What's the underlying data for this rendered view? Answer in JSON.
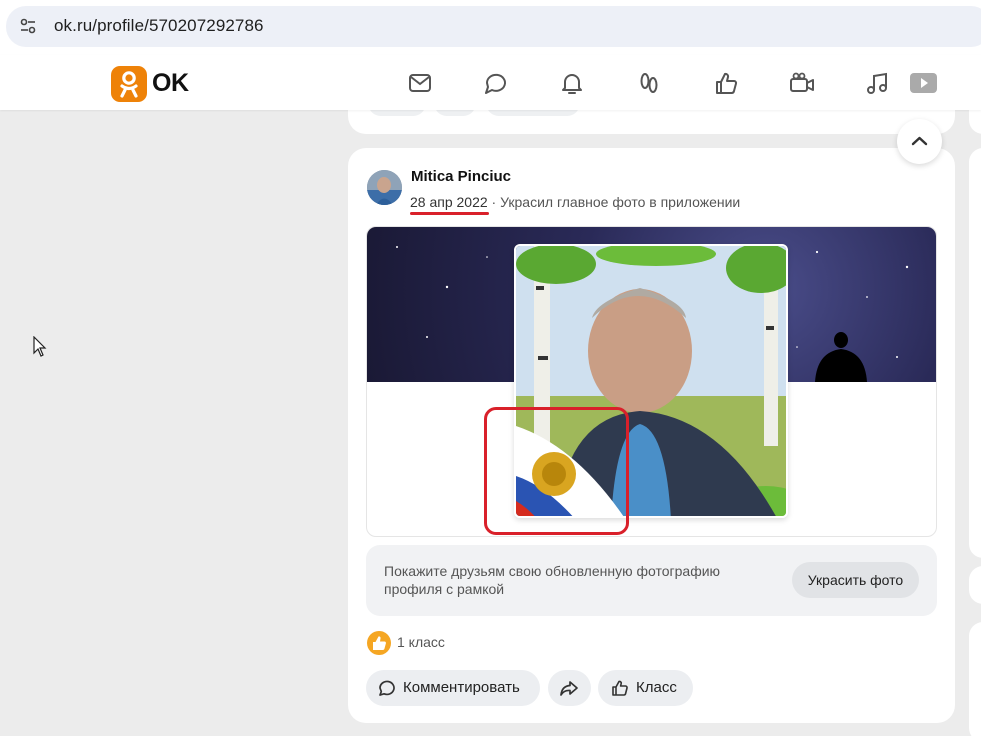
{
  "browser": {
    "url": "ok.ru/profile/570207292786",
    "icons": {
      "site_settings": "tune-icon"
    }
  },
  "header": {
    "logo_text": "OK",
    "nav_icons": [
      "messages-icon",
      "discussions-icon",
      "notifications-icon",
      "guests-icon",
      "likes-icon",
      "video-calls-icon",
      "music-icon",
      "video-icon"
    ],
    "accent_color": "#ee8208"
  },
  "post": {
    "author": "Mitica Pinciuc",
    "date": "28 апр 2022",
    "separator": "·",
    "action": "Украсил главное фото в приложении",
    "promo_text": "Покажите друзьям свою обновленную фотографию профиля с рамкой",
    "promo_button": "Украсить фото",
    "likes": "1 класс",
    "buttons": {
      "comment": "Комментировать",
      "like": "Класс"
    },
    "highlight_color": "#d9202a"
  }
}
